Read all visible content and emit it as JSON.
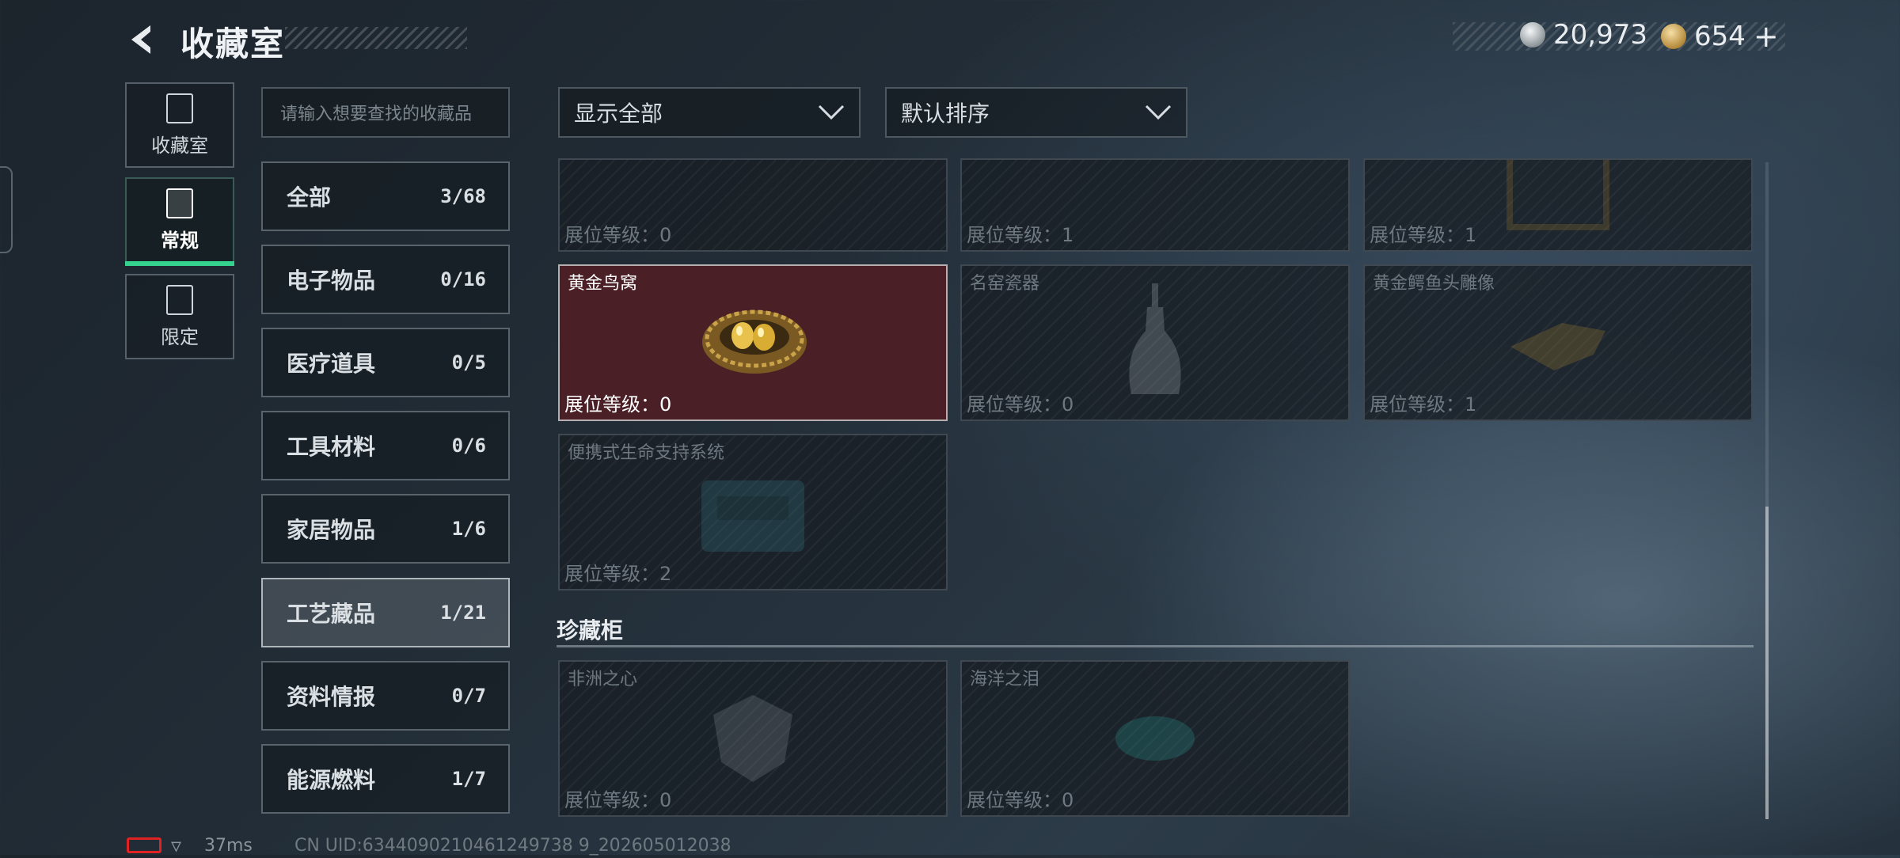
{
  "header": {
    "title": "收藏室",
    "currencies": [
      {
        "icon": "silver-coin-icon",
        "value": "20,973"
      },
      {
        "icon": "gold-coin-icon",
        "value": "654",
        "add": "+"
      }
    ]
  },
  "nav": [
    {
      "label": "收藏室",
      "icon": "collection-room-icon"
    },
    {
      "label": "常规",
      "icon": "regular-icon",
      "active": true
    },
    {
      "label": "限定",
      "icon": "limited-icon"
    }
  ],
  "search": {
    "placeholder": "请输入想要查找的收藏品"
  },
  "categories": [
    {
      "label": "全部",
      "count": "3/68"
    },
    {
      "label": "电子物品",
      "count": "0/16"
    },
    {
      "label": "医疗道具",
      "count": "0/5"
    },
    {
      "label": "工具材料",
      "count": "0/6"
    },
    {
      "label": "家居物品",
      "count": "1/6"
    },
    {
      "label": "工艺藏品",
      "count": "1/21",
      "active": true
    },
    {
      "label": "资料情报",
      "count": "0/7"
    },
    {
      "label": "能源燃料",
      "count": "1/7"
    }
  ],
  "filters": {
    "show": "显示全部",
    "sort": "默认排序"
  },
  "grid": {
    "items": [
      {
        "name": "",
        "level": "展位等级：0"
      },
      {
        "name": "",
        "level": "展位等级：1"
      },
      {
        "name": "",
        "level": "展位等级：1"
      },
      {
        "name": "黄金鸟窝",
        "level": "展位等级：0",
        "selected": true
      },
      {
        "name": "名窑瓷器",
        "level": "展位等级：0"
      },
      {
        "name": "黄金鳄鱼头雕像",
        "level": "展位等级：1"
      },
      {
        "name": "便携式生命支持系统",
        "level": "展位等级：2"
      }
    ],
    "section_title": "珍藏柜",
    "section_items": [
      {
        "name": "非洲之心",
        "level": "展位等级：0"
      },
      {
        "name": "海洋之泪",
        "level": "展位等级：0"
      }
    ]
  },
  "status": {
    "ping": "37ms",
    "uid": "CN UID:6344090210461249738 9_202605012038"
  },
  "colors": {
    "accent": "#35d18e",
    "selected_card": "#4a1f26",
    "battery": "#e02222"
  }
}
